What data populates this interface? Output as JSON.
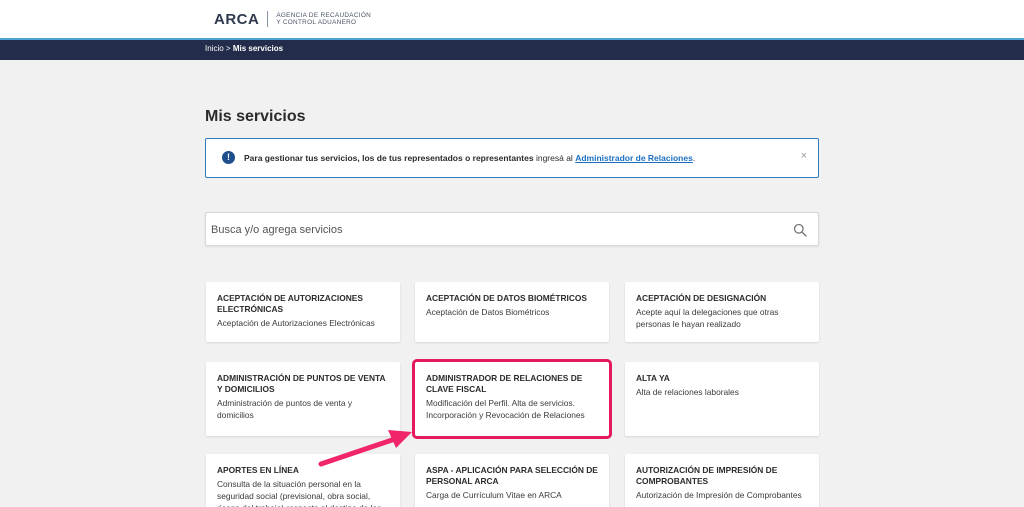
{
  "header": {
    "logo_text": "ARCA",
    "logo_sub_line1": "AGENCIA DE RECAUDACIÓN",
    "logo_sub_line2": "Y CONTROL ADUANERO"
  },
  "breadcrumb": {
    "home": "Inicio",
    "separator": ">",
    "current": "Mis servicios"
  },
  "page": {
    "title": "Mis servicios"
  },
  "alert": {
    "icon": "info-icon",
    "text_bold": "Para gestionar tus servicios, los de tus representados o representantes",
    "text_normal": " ingresá al ",
    "link": "Administrador de Relaciones",
    "text_end": ".",
    "close": "×"
  },
  "search": {
    "placeholder": "Busca y/o agrega servicios"
  },
  "colors": {
    "navbar": "#232c4a",
    "accent_line": "#4ca3d1",
    "link": "#1a6fc0",
    "highlight": "#e5195f"
  },
  "services": [
    {
      "title": "ACEPTACIÓN DE AUTORIZACIONES ELECTRÓNICAS",
      "desc": "Aceptación de Autorizaciones Electrónicas"
    },
    {
      "title": "ACEPTACIÓN DE DATOS BIOMÉTRICOS",
      "desc": "Aceptación de Datos Biométricos"
    },
    {
      "title": "ACEPTACIÓN DE DESIGNACIÓN",
      "desc": "Acepte aquí la delegaciones que otras personas le hayan realizado"
    },
    {
      "title": "ADMINISTRACIÓN DE PUNTOS DE VENTA Y DOMICILIOS",
      "desc": "Administración de puntos de venta y domicilios"
    },
    {
      "title": "ADMINISTRADOR DE RELACIONES DE CLAVE FISCAL",
      "desc": "Modificación del Perfil. Alta de servicios. Incorporación y Revocación de Relaciones"
    },
    {
      "title": "ALTA YA",
      "desc": "Alta de relaciones laborales"
    },
    {
      "title": "APORTES EN LÍNEA",
      "desc": "Consulta de la situación personal en la seguridad social (previsional, obra social, riesgo del trabajo) respecto al destino de los"
    },
    {
      "title": "ASPA - APLICACIÓN PARA SELECCIÓN DE PERSONAL ARCA",
      "desc": "Carga de Currículum Vitae en ARCA"
    },
    {
      "title": "AUTORIZACIÓN DE IMPRESIÓN DE COMPROBANTES",
      "desc": "Autorización de Impresión de Comprobantes"
    }
  ]
}
